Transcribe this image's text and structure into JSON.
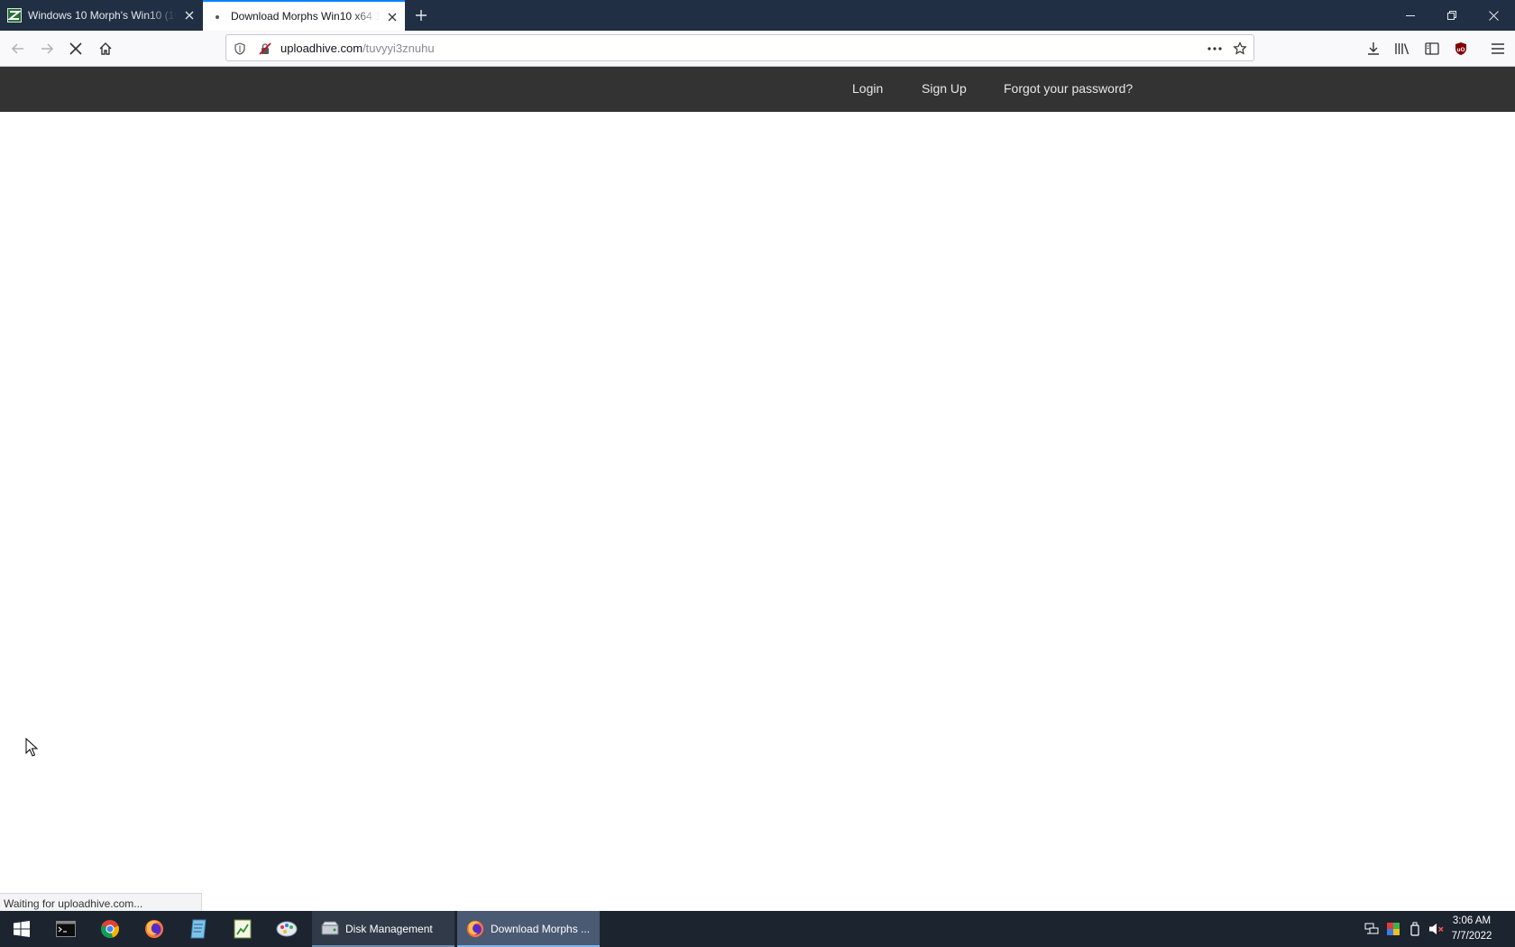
{
  "browser": {
    "tabs": [
      {
        "title": "Windows 10 Morph's Win10 (16",
        "active": false
      },
      {
        "title": "Download Morphs Win10 x64 1",
        "active": true
      }
    ],
    "url": {
      "host": "uploadhive.com",
      "path": "/tuvyyi3znuhu"
    },
    "status_text": "Waiting for uploadhive.com..."
  },
  "site_nav": {
    "links": [
      "Login",
      "Sign Up",
      "Forgot your password?"
    ],
    "background": "#333333"
  },
  "taskbar": {
    "pinned": [
      "start-icon",
      "terminal-icon",
      "chrome-icon",
      "firefox-icon",
      "notepad-icon",
      "spreadsheet-icon",
      "paint-icon"
    ],
    "tasks": [
      {
        "label": "Disk Management",
        "active": false
      },
      {
        "label": "Download Morphs ...",
        "active": true
      }
    ],
    "clock": {
      "time": "3:06 AM",
      "date": "7/7/2022"
    }
  },
  "colors": {
    "tabbar": "#202f43",
    "accent": "#0a84ff",
    "taskbar": "#1c2430"
  }
}
